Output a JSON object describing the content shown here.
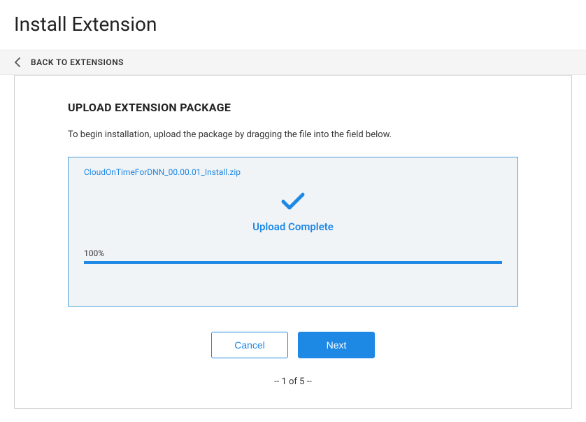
{
  "header": {
    "title": "Install Extension"
  },
  "back_nav": {
    "label": "BACK TO EXTENSIONS"
  },
  "main": {
    "section_title": "UPLOAD EXTENSION PACKAGE",
    "description": "To begin installation, upload the package by dragging the file into the field below.",
    "upload": {
      "file_name": "CloudOnTimeForDNN_00.00.01_Install.zip",
      "status_text": "Upload Complete",
      "progress_percent": "100%"
    },
    "buttons": {
      "cancel_label": "Cancel",
      "next_label": "Next"
    },
    "step_indicator": "-- 1 of 5 --"
  },
  "colors": {
    "accent": "#1e88e5"
  }
}
